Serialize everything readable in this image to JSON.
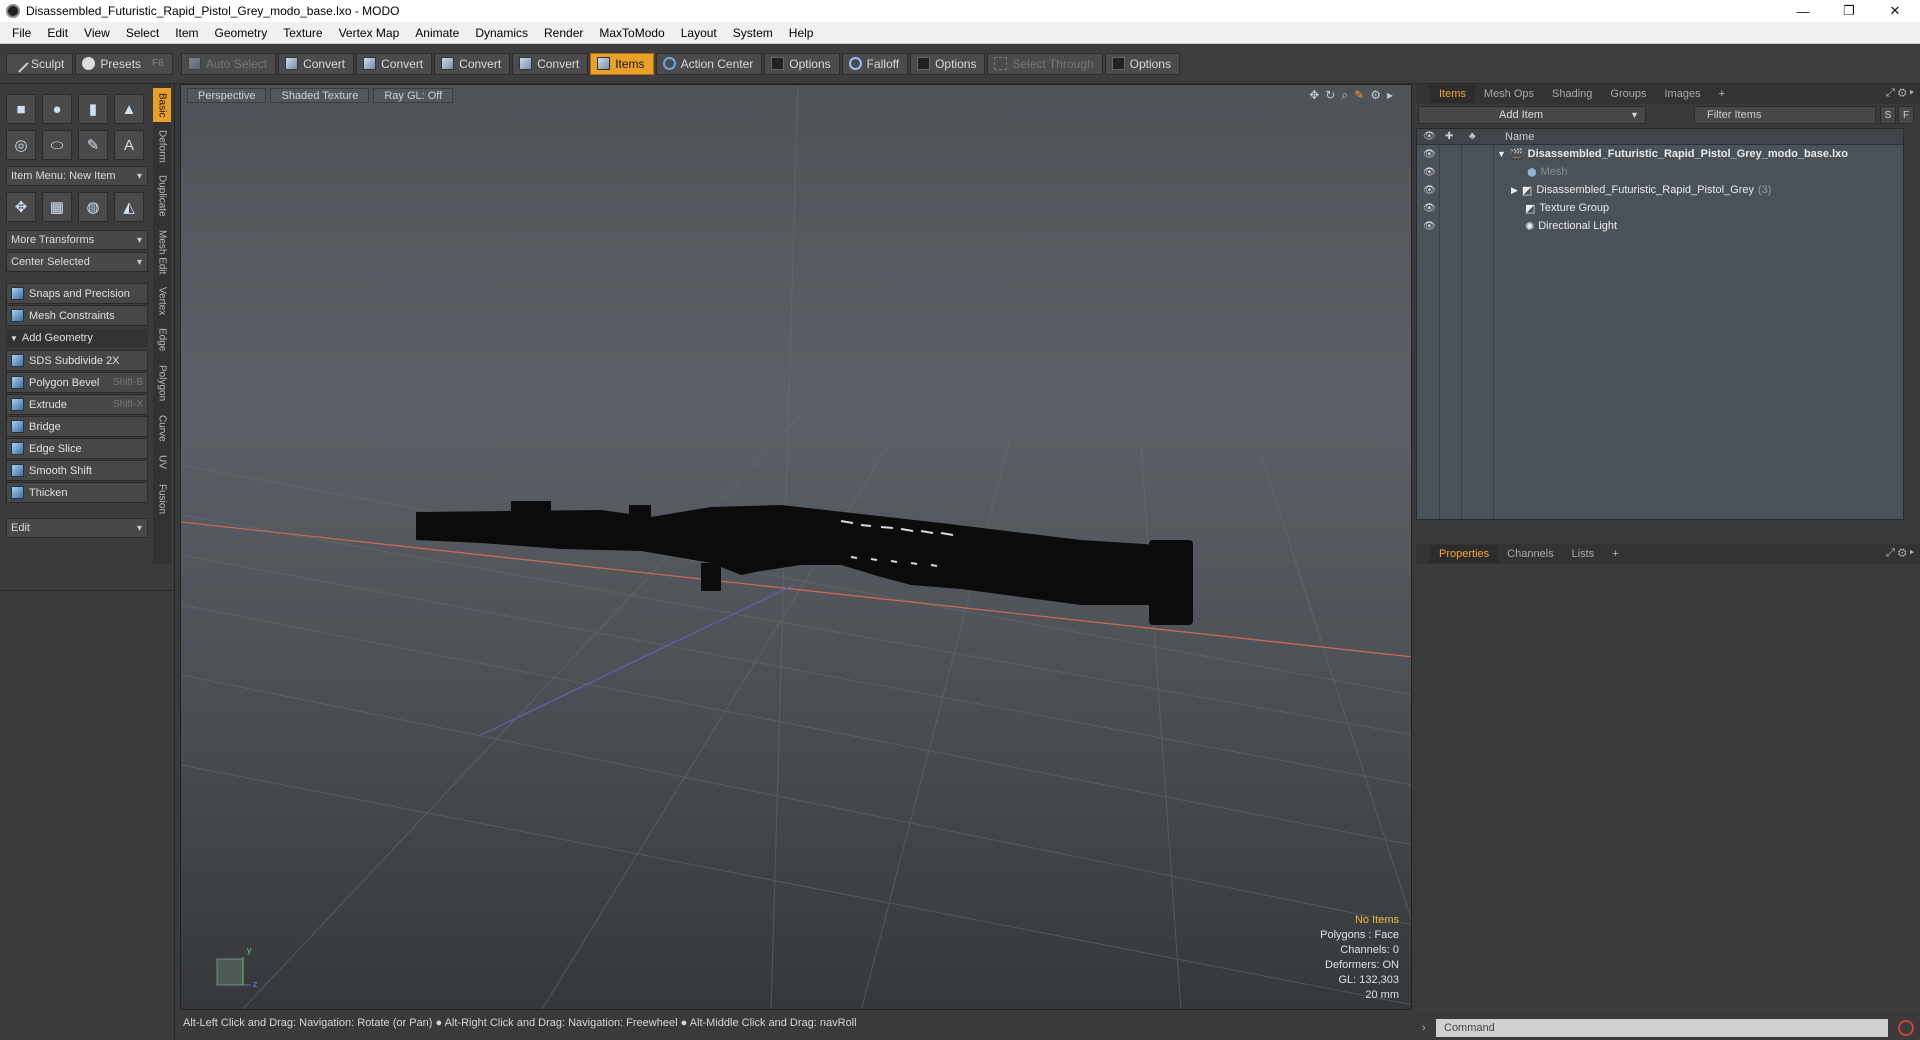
{
  "window": {
    "title": "Disassembled_Futuristic_Rapid_Pistol_Grey_modo_base.lxo - MODO",
    "minimize": "—",
    "maximize": "❐",
    "close": "✕"
  },
  "menu": [
    "File",
    "Edit",
    "View",
    "Select",
    "Item",
    "Geometry",
    "Texture",
    "Vertex Map",
    "Animate",
    "Dynamics",
    "Render",
    "MaxToModo",
    "Layout",
    "System",
    "Help"
  ],
  "toolbar": {
    "sculpt": "Sculpt",
    "presets": "Presets",
    "presets_key": "F6",
    "auto_select": "Auto Select",
    "convert1": "Convert",
    "convert2": "Convert",
    "convert3": "Convert",
    "convert4": "Convert",
    "items": "Items",
    "action_center": "Action Center",
    "options1": "Options",
    "falloff": "Falloff",
    "options2": "Options",
    "select_through": "Select Through",
    "options3": "Options"
  },
  "left": {
    "item_menu": "Item Menu: New Item",
    "more_transforms": "More Transforms",
    "center_selected": "Center Selected",
    "snaps": "Snaps and Precision",
    "mesh_constraints": "Mesh Constraints",
    "add_geometry": "Add Geometry",
    "tools": [
      {
        "label": "SDS Subdivide 2X",
        "key": ""
      },
      {
        "label": "Polygon Bevel",
        "key": "Shift-B"
      },
      {
        "label": "Extrude",
        "key": "Shift-X"
      },
      {
        "label": "Bridge",
        "key": ""
      },
      {
        "label": "Edge Slice",
        "key": ""
      },
      {
        "label": "Smooth Shift",
        "key": ""
      },
      {
        "label": "Thicken",
        "key": ""
      }
    ],
    "edit": "Edit",
    "vtabs": [
      "Basic",
      "Deform",
      "Duplicate",
      "Mesh Edit",
      "Vertex",
      "Edge",
      "Polygon",
      "Curve",
      "UV",
      "Fusion"
    ]
  },
  "viewport": {
    "tabs": [
      "Perspective",
      "Shaded Texture",
      "Ray GL: Off"
    ],
    "info": {
      "selection": "No Items",
      "polygons": "Polygons : Face",
      "channels": "Channels: 0",
      "deformers": "Deformers: ON",
      "gl": "GL: 132,303",
      "scale": "20 mm"
    },
    "axis_y": "y",
    "axis_z": "z"
  },
  "status": "Alt-Left Click and Drag: Navigation: Rotate (or Pan) ● Alt-Right Click and Drag: Navigation: Freewheel ● Alt-Middle Click and Drag: navRoll",
  "right": {
    "tabs": [
      "Items",
      "Mesh Ops",
      "Shading",
      "Groups",
      "Images"
    ],
    "add_item": "Add Item",
    "filter": "Filter Items",
    "s_btn": "S",
    "f_btn": "F",
    "name_col": "Name",
    "tree": [
      {
        "label": "Disassembled_Futuristic_Rapid_Pistol_Grey_modo_base.lxo",
        "count": ""
      },
      {
        "label": "Mesh",
        "count": ""
      },
      {
        "label": "Disassembled_Futuristic_Rapid_Pistol_Grey",
        "count": "(3)"
      },
      {
        "label": "Texture Group",
        "count": ""
      },
      {
        "label": "Directional Light",
        "count": ""
      }
    ],
    "prop_tabs": [
      "Properties",
      "Channels",
      "Lists"
    ],
    "command_placeholder": "Command"
  },
  "colors": {
    "accent": "#e8a02a",
    "warn": "#f0b43c"
  }
}
